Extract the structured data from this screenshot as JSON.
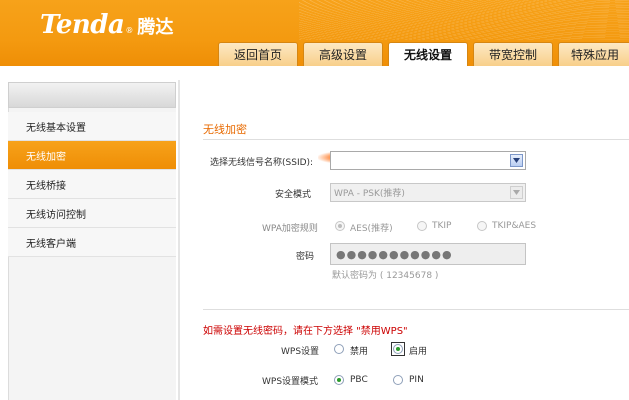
{
  "brand": {
    "logo_text": "Tenda",
    "logo_reg": "®",
    "logo_cn": "腾达"
  },
  "tabs": [
    {
      "label": "返回首页",
      "active": false
    },
    {
      "label": "高级设置",
      "active": false
    },
    {
      "label": "无线设置",
      "active": true
    },
    {
      "label": "带宽控制",
      "active": false
    },
    {
      "label": "特殊应用",
      "active": false
    }
  ],
  "sidebar": {
    "items": [
      {
        "label": "无线基本设置",
        "active": false
      },
      {
        "label": "无线加密",
        "active": true
      },
      {
        "label": "无线桥接",
        "active": false
      },
      {
        "label": "无线访问控制",
        "active": false
      },
      {
        "label": "无线客户端",
        "active": false
      }
    ]
  },
  "main": {
    "section_title": "无线加密",
    "ssid": {
      "label": "选择无线信号名称(SSID):",
      "value": ""
    },
    "security_mode": {
      "label": "安全模式",
      "value": "WPA - PSK(推荐)"
    },
    "wpa_rule": {
      "label": "WPA加密规则",
      "options": [
        {
          "label": "AES(推荐)",
          "checked": true
        },
        {
          "label": "TKIP",
          "checked": false
        },
        {
          "label": "TKIP&AES",
          "checked": false
        }
      ]
    },
    "password": {
      "label": "密码",
      "value": "●●●●●●●●●●●",
      "hint": "默认密码为 ( 12345678 )"
    },
    "wps_notice": "如需设置无线密码，请在下方选择 \"禁用WPS\"",
    "wps_setting": {
      "label": "WPS设置",
      "options": [
        {
          "label": "禁用",
          "checked": false
        },
        {
          "label": "启用",
          "checked": true
        }
      ]
    },
    "wps_mode": {
      "label": "WPS设置模式",
      "options": [
        {
          "label": "PBC",
          "checked": true
        },
        {
          "label": "PIN",
          "checked": false
        }
      ]
    }
  },
  "colors": {
    "brand_orange": "#f49a10",
    "title_orange": "#e86a00",
    "warning_red": "#cc0000"
  }
}
